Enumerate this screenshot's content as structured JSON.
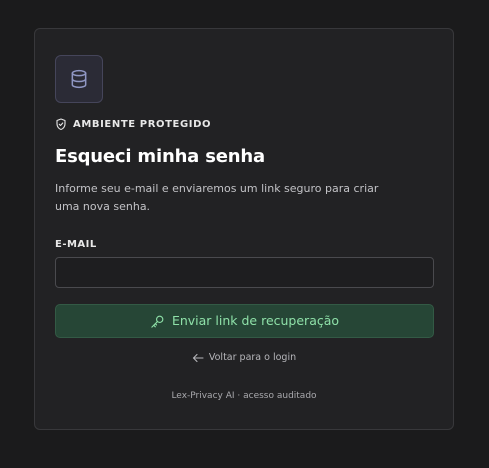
{
  "colors": {
    "page_background": "#1b1b1c",
    "card_background": "#222224",
    "accent_green": "#8ee0a8",
    "button_background": "#264636",
    "logo_tint": "#9097c4"
  },
  "logo": {
    "icon": "database-icon"
  },
  "badge": {
    "icon": "shield-check-icon",
    "label": "AMBIENTE PROTEGIDO"
  },
  "title": "Esqueci minha senha",
  "description": "Informe seu e-mail e enviaremos um link seguro para criar uma nova senha.",
  "email": {
    "label": "E-MAIL",
    "value": "",
    "placeholder": ""
  },
  "submit": {
    "icon": "key-icon",
    "label": "Enviar link de recuperação"
  },
  "back": {
    "icon": "arrow-left-icon",
    "label": "Voltar para o login"
  },
  "footer": "Lex-Privacy AI · acesso auditado"
}
